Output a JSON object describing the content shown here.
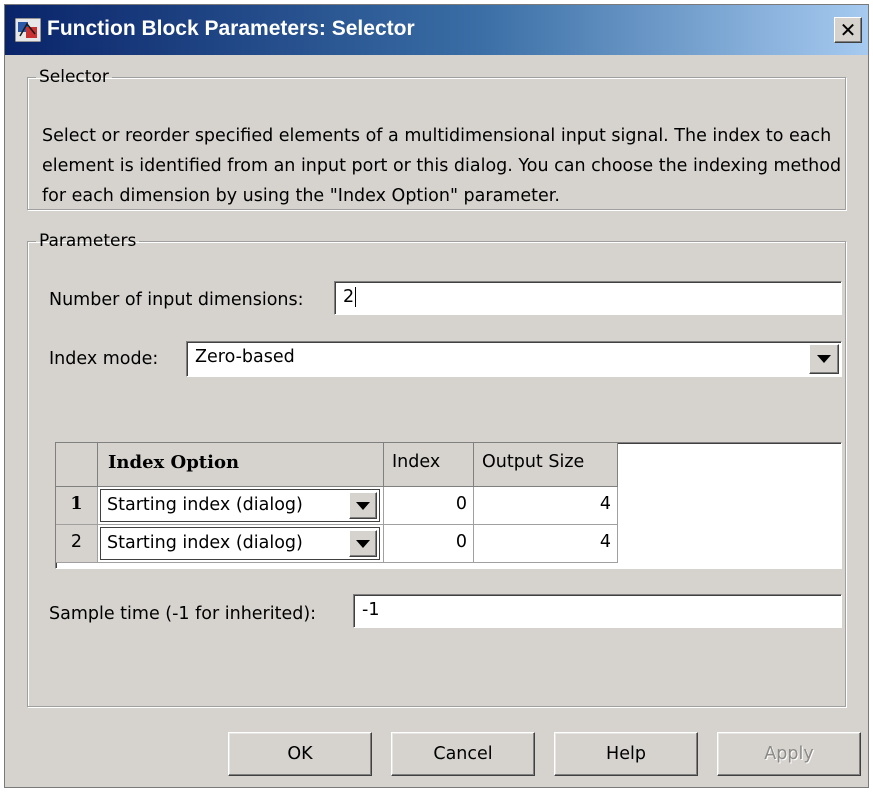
{
  "window": {
    "title": "Function Block Parameters: Selector",
    "close_glyph": "✕",
    "icon": "simulink-block-icon"
  },
  "selector_group": {
    "legend": "Selector",
    "description": "Select or reorder specified elements of a multidimensional input signal. The index to each element is identified from an input port or this dialog. You can choose the indexing method for each dimension by using the \"Index Option\" parameter."
  },
  "parameters_group": {
    "legend": "Parameters",
    "num_dims": {
      "label": "Number of input dimensions:",
      "value": "2"
    },
    "index_mode": {
      "label": "Index mode:",
      "value": "Zero-based"
    },
    "table": {
      "headers": [
        "Index Option",
        "Index",
        "Output Size"
      ],
      "rows": [
        {
          "num": "1",
          "option": "Starting index (dialog)",
          "index": "0",
          "output_size": "4"
        },
        {
          "num": "2",
          "option": "Starting index (dialog)",
          "index": "0",
          "output_size": "4"
        }
      ]
    },
    "sample_time": {
      "label": "Sample time (-1 for inherited):",
      "value": "-1"
    }
  },
  "buttons": {
    "ok": "OK",
    "cancel": "Cancel",
    "help": "Help",
    "apply": "Apply"
  },
  "colors": {
    "dialog_bg": "#d6d3ce",
    "titlebar_start": "#0a246a",
    "titlebar_end": "#a6caf0"
  }
}
